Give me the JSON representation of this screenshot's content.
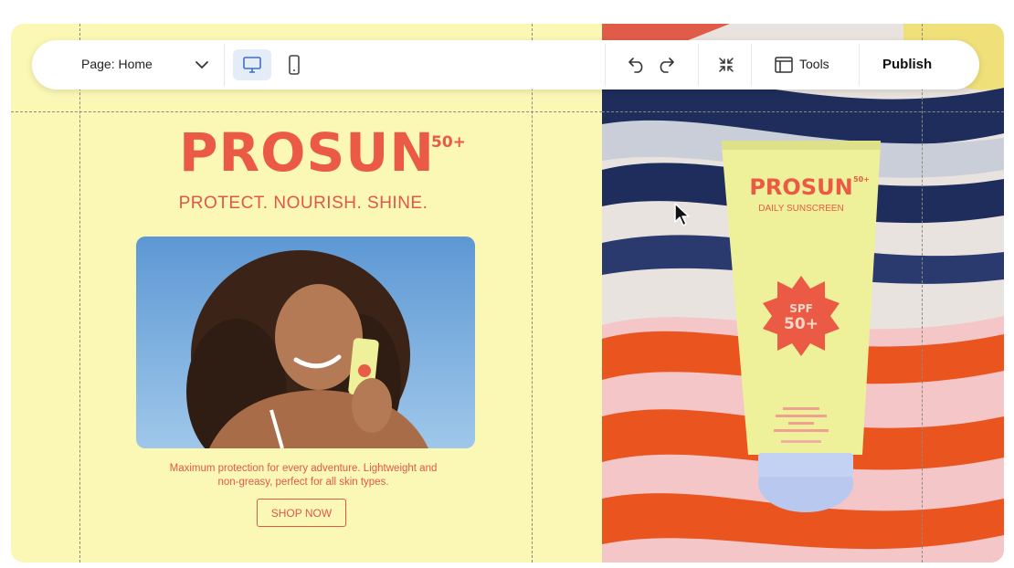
{
  "toolbar": {
    "page_label": "Page: Home",
    "tools_label": "Tools",
    "publish_label": "Publish"
  },
  "site": {
    "brand": "PROSUN",
    "brand_sup": "50+",
    "tagline": "PROTECT. NOURISH. SHINE.",
    "description": "Maximum protection for every adventure. Lightweight and non-greasy, perfect for all skin types.",
    "cta_label": "SHOP NOW",
    "product_subtitle": "DAILY SUNSCREEN",
    "spf_line1": "SPF",
    "spf_line2": "50+"
  },
  "colors": {
    "background": "#fbf7b5",
    "accent": "#ea5a45",
    "tube": "#eef09a",
    "cap": "#b8c8ef"
  },
  "icons": [
    "chevron-down-icon",
    "desktop-icon",
    "mobile-icon",
    "undo-icon",
    "redo-icon",
    "collapse-icon",
    "tools-icon",
    "cursor-icon"
  ]
}
